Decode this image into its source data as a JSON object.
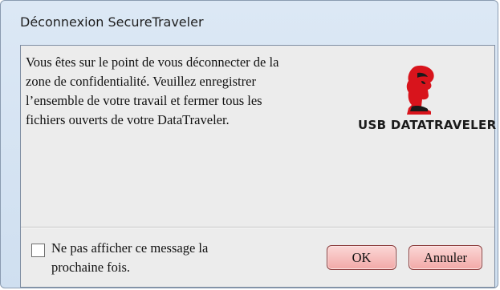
{
  "window": {
    "title": "Déconnexion SecureTraveler"
  },
  "message": {
    "lines": [
      "Vous êtes sur le point de vous déconnecter de la",
      "zone de confidentialité. Veuillez enregistrer",
      "l’ensemble de votre travail et fermer tous les",
      "fichiers ouverts de votre DataTraveler."
    ]
  },
  "logo": {
    "text": "USB DATATRAVELER",
    "icon": "kingston-head-logo",
    "color": "#d8141c"
  },
  "options": {
    "dont_show_checked": false,
    "dont_show_lines": [
      "Ne pas afficher ce message la",
      "prochaine fois."
    ]
  },
  "buttons": {
    "ok_label": "OK",
    "cancel_label": "Annuler",
    "color": "#f2a9a7"
  }
}
